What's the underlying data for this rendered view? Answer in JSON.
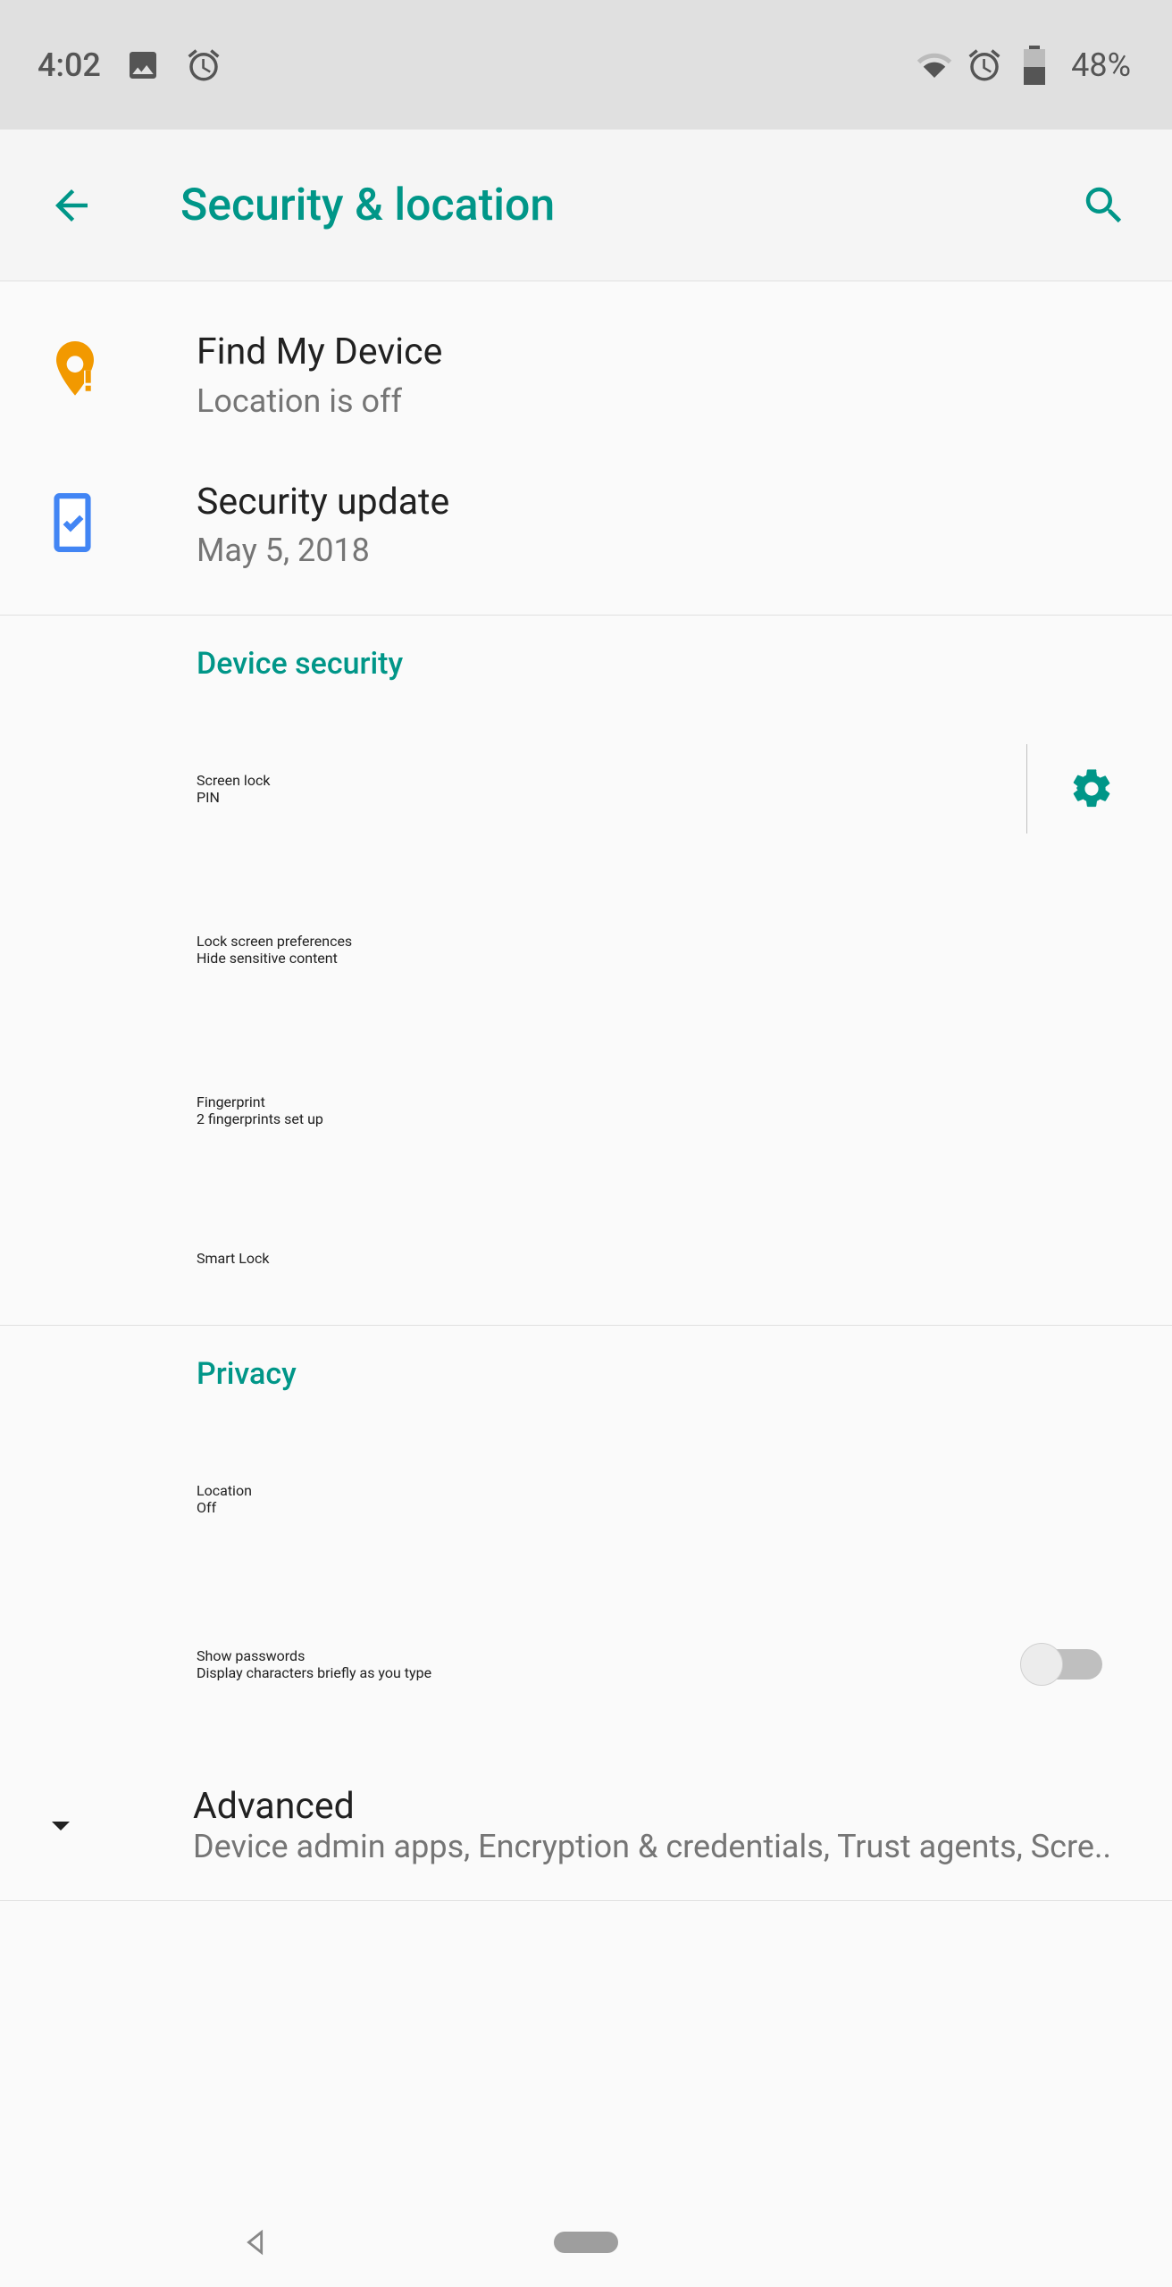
{
  "status": {
    "time": "4:02",
    "battery_pct": "48%"
  },
  "appbar": {
    "title": "Security & location"
  },
  "top_items": {
    "find": {
      "title": "Find My Device",
      "sub": "Location is off"
    },
    "update": {
      "title": "Security update",
      "sub": "May 5, 2018"
    }
  },
  "sections": {
    "device_security": {
      "header": "Device security",
      "screen_lock": {
        "title": "Screen lock",
        "sub": "PIN"
      },
      "lock_prefs": {
        "title": "Lock screen preferences",
        "sub": "Hide sensitive content"
      },
      "fingerprint": {
        "title": "Fingerprint",
        "sub": "2 fingerprints set up"
      },
      "smart_lock": {
        "title": "Smart Lock"
      }
    },
    "privacy": {
      "header": "Privacy",
      "location": {
        "title": "Location",
        "sub": "Off"
      },
      "show_pw": {
        "title": "Show passwords",
        "sub": "Display characters briefly as you type"
      },
      "advanced": {
        "title": "Advanced",
        "sub": "Device admin apps, Encryption & credentials, Trust agents, Scre.."
      }
    }
  }
}
